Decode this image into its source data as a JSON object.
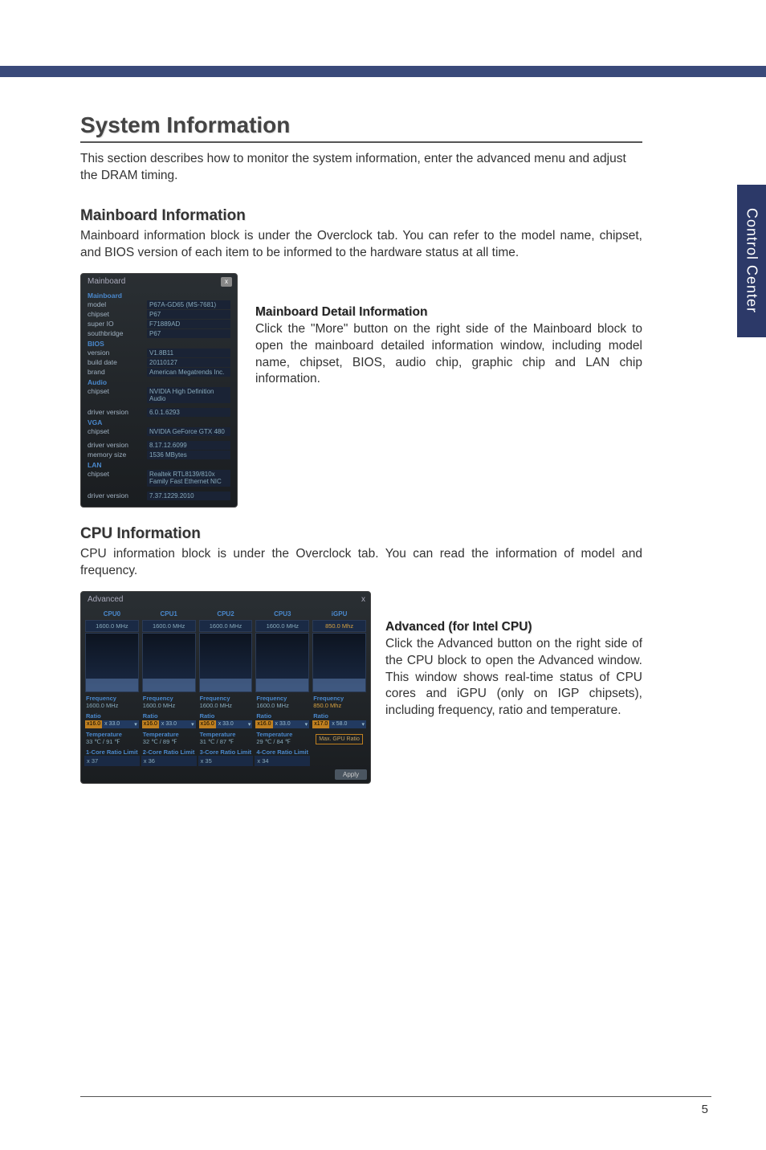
{
  "sideTab": "Control Center",
  "pageNumber": "5",
  "title": "System Information",
  "intro": "This section describes how to monitor the system information, enter the advanced menu and adjust the DRAM timing.",
  "sections": {
    "mainboard": {
      "title": "Mainboard Information",
      "body": "Mainboard information block is under the Overclock tab. You can refer to the model name, chipset, and BIOS version of each item to be informed to the hardware status at all time.",
      "detailTitle": "Mainboard Detail Information",
      "detailBody": "Click the \"More\" button on the right side of the Mainboard block to open the mainboard detailed information window, including model name, chipset, BIOS, audio chip, graphic chip and LAN chip information."
    },
    "cpu": {
      "title": "CPU Information",
      "body": "CPU information block is under the Overclock tab. You can read the information of model and frequency.",
      "advTitle": "Advanced (for Intel CPU)",
      "advBody": "Click the Advanced button on the right side of the CPU block to open the Advanced window. This window shows real-time status of CPU cores and iGPU (only on IGP chipsets), including frequency, ratio and temperature."
    }
  },
  "mbPanel": {
    "title": "Mainboard",
    "close": "x",
    "groups": {
      "mainboard": "Mainboard",
      "bios": "BIOS",
      "audio": "Audio",
      "vga": "VGA",
      "lan": "LAN"
    },
    "rows": {
      "model": {
        "l": "model",
        "v": "P67A-GD65 (MS-7681)"
      },
      "chipset": {
        "l": "chipset",
        "v": "P67"
      },
      "superio": {
        "l": "super IO",
        "v": "F71889AD"
      },
      "southbridge": {
        "l": "southbridge",
        "v": "P67"
      },
      "version": {
        "l": "version",
        "v": "V1.8B11"
      },
      "builddate": {
        "l": "build date",
        "v": "20110127"
      },
      "brand": {
        "l": "brand",
        "v": "American Megatrends Inc."
      },
      "audiochip": {
        "l": "chipset",
        "v": "NVIDIA High Definition Audio"
      },
      "audiodrv": {
        "l": "driver version",
        "v": "6.0.1.6293"
      },
      "vgachip": {
        "l": "chipset",
        "v": "NVIDIA GeForce GTX 480"
      },
      "vgadrv": {
        "l": "driver version",
        "v": "8.17.12.6099"
      },
      "vgamem": {
        "l": "memory size",
        "v": "1536 MBytes"
      },
      "lanchip": {
        "l": "chipset",
        "v": "Realtek RTL8139/810x Family Fast Ethernet NIC"
      },
      "landrv": {
        "l": "driver version",
        "v": "7.37.1229.2010"
      }
    }
  },
  "advPanel": {
    "title": "Advanced",
    "close": "x",
    "apply": "Apply",
    "heads": [
      "CPU0",
      "CPU1",
      "CPU2",
      "CPU3",
      "iGPU"
    ],
    "topFreq": [
      "1600.0 MHz",
      "1600.0 MHz",
      "1600.0 MHz",
      "1600.0 MHz",
      "850.0 Mhz"
    ],
    "labels": {
      "freq": "Frequency",
      "ratio": "Ratio",
      "temp": "Temperature",
      "core1": "1-Core Ratio Limit",
      "core2": "2-Core Ratio Limit",
      "core3": "3-Core Ratio Limit",
      "core4": "4-Core Ratio Limit",
      "maxgpu": "Max. GPU Ratio"
    },
    "freqVals": [
      "1600.0 MHz",
      "1600.0 MHz",
      "1600.0 MHz",
      "1600.0 MHz",
      "850.0 Mhz"
    ],
    "ratioA": [
      "x16.0",
      "x16.0",
      "x16.0",
      "x16.0",
      "x17.0"
    ],
    "ratioB": [
      "x 33.0",
      "x 33.0",
      "x 33.0",
      "x 33.0",
      "x 58.0"
    ],
    "ratioC": [
      "▾",
      "▾",
      "▾",
      "▾",
      "▾"
    ],
    "tempVals": [
      "33 ℃ / 91 ℉",
      "32 ℃ / 89 ℉",
      "31 ℃ / 87 ℉",
      "29 ℃ / 84 ℉"
    ],
    "coreLimits": [
      "x 37",
      "x 36",
      "x 35",
      "x 34"
    ]
  }
}
